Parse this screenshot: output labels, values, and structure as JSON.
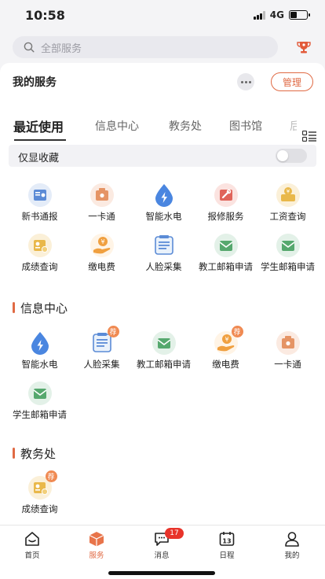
{
  "status": {
    "time": "10:58",
    "network": "4G"
  },
  "search": {
    "placeholder": "全部服务"
  },
  "my_services": {
    "title": "我的服务",
    "manage_label": "管理"
  },
  "tabs": [
    {
      "label": "最近使用",
      "active": true
    },
    {
      "label": "信息中心",
      "active": false
    },
    {
      "label": "教务处",
      "active": false
    },
    {
      "label": "图书馆",
      "active": false
    },
    {
      "label": "后",
      "active": false
    }
  ],
  "favorites_toggle": {
    "label": "仅显收藏",
    "on": false
  },
  "recent": [
    {
      "label": "新书通报",
      "icon": "book-news-icon",
      "recommended": false
    },
    {
      "label": "一卡通",
      "icon": "card-icon",
      "recommended": false
    },
    {
      "label": "智能水电",
      "icon": "water-power-icon",
      "recommended": false
    },
    {
      "label": "报修服务",
      "icon": "repair-icon",
      "recommended": false
    },
    {
      "label": "工资查询",
      "icon": "salary-icon",
      "recommended": false
    },
    {
      "label": "成绩查询",
      "icon": "grade-icon",
      "recommended": false
    },
    {
      "label": "缴电费",
      "icon": "pay-electricity-icon",
      "recommended": false
    },
    {
      "label": "人脸采集",
      "icon": "face-collect-icon",
      "recommended": false
    },
    {
      "label": "教工邮箱申请",
      "icon": "staff-mail-icon",
      "recommended": false
    },
    {
      "label": "学生邮箱申请",
      "icon": "student-mail-icon",
      "recommended": false
    }
  ],
  "sections": [
    {
      "title": "信息中心",
      "items": [
        {
          "label": "智能水电",
          "icon": "water-power-icon",
          "recommended": false
        },
        {
          "label": "人脸采集",
          "icon": "face-collect-icon",
          "recommended": true
        },
        {
          "label": "教工邮箱申请",
          "icon": "staff-mail-icon",
          "recommended": false
        },
        {
          "label": "缴电费",
          "icon": "pay-electricity-icon",
          "recommended": true
        },
        {
          "label": "一卡通",
          "icon": "card-icon",
          "recommended": false
        },
        {
          "label": "学生邮箱申请",
          "icon": "student-mail-icon",
          "recommended": false
        }
      ]
    },
    {
      "title": "教务处",
      "items": [
        {
          "label": "成绩查询",
          "icon": "grade-icon",
          "recommended": true
        }
      ]
    }
  ],
  "recommend_badge": "荐",
  "tabbar": [
    {
      "label": "首页",
      "icon": "home-icon",
      "active": false
    },
    {
      "label": "服务",
      "icon": "service-box-icon",
      "active": true
    },
    {
      "label": "消息",
      "icon": "message-icon",
      "active": false,
      "badge": "17"
    },
    {
      "label": "日程",
      "icon": "calendar-icon",
      "active": false,
      "date": "13"
    },
    {
      "label": "我的",
      "icon": "profile-icon",
      "active": false
    }
  ],
  "colors": {
    "accent": "#e06a44",
    "badge_red": "#e8332a",
    "recommend_orange": "#f08a52"
  }
}
